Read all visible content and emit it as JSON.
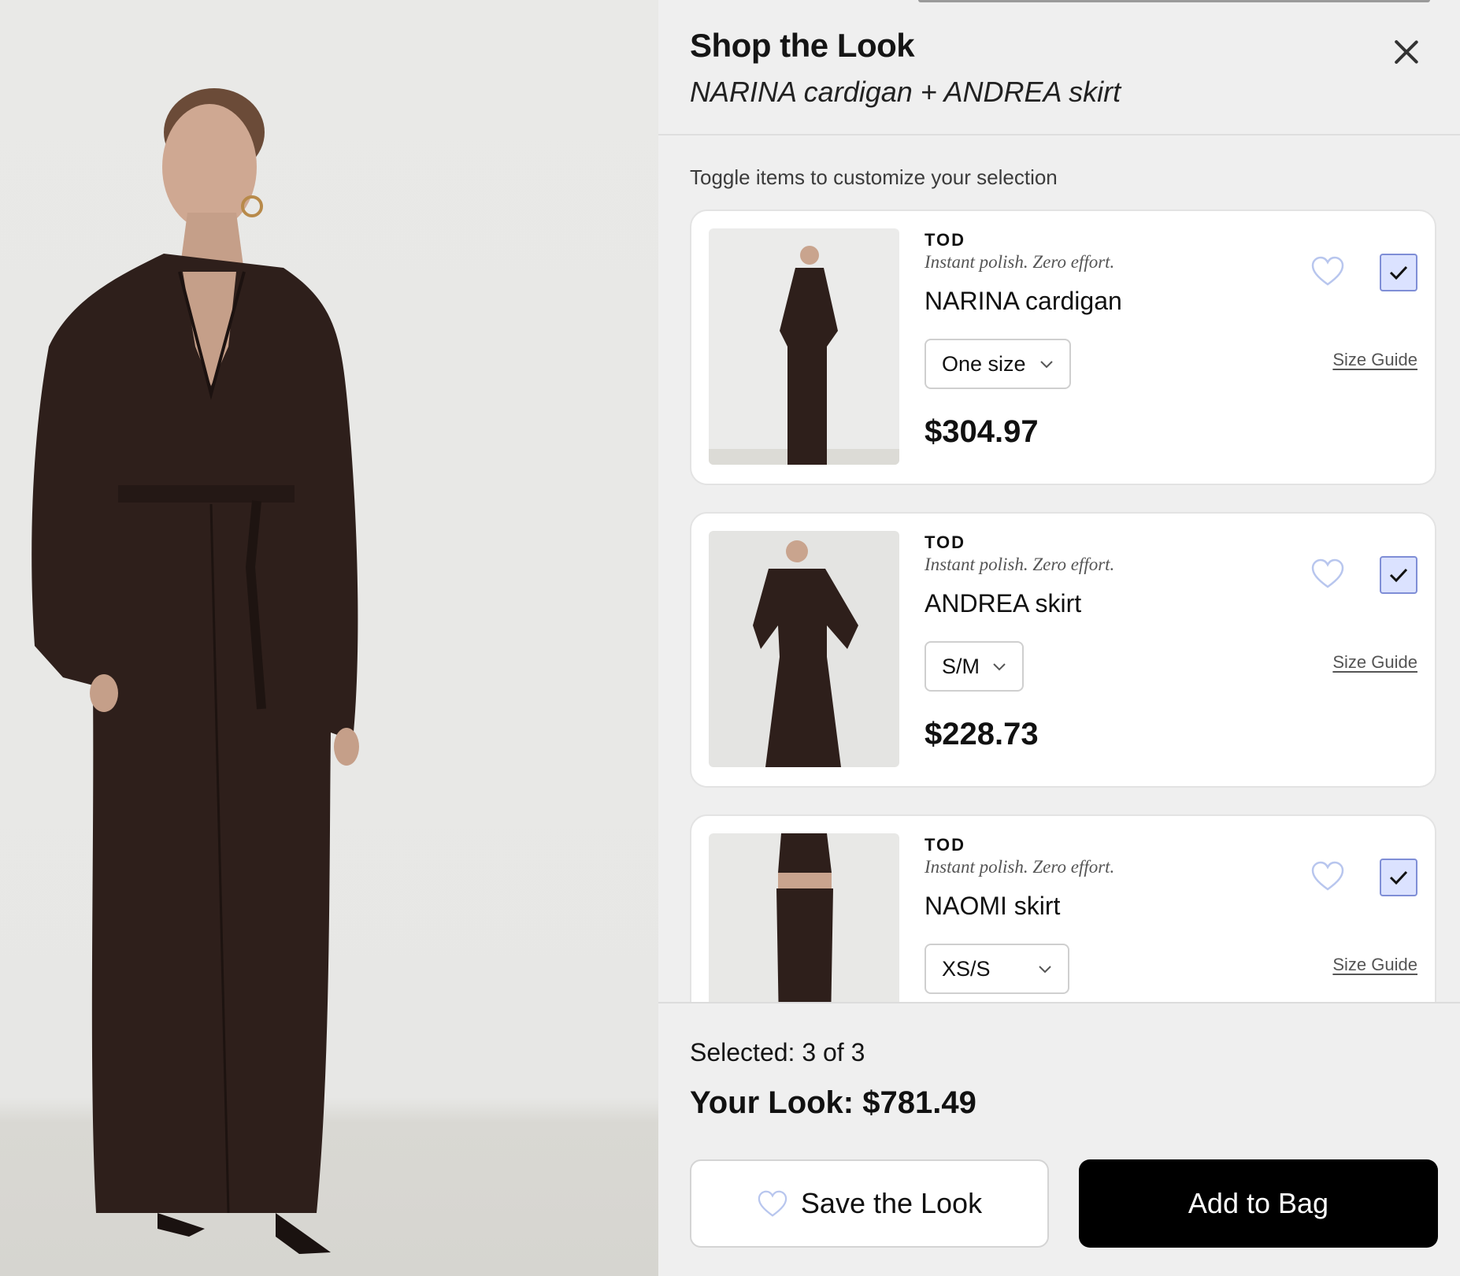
{
  "hero": {
    "alt": "Model wearing long brown belted cardigan over skirt"
  },
  "panel": {
    "title": "Shop the Look",
    "subtitle": "NARINA cardigan + ANDREA skirt",
    "close_icon": "close-icon",
    "hint": "Toggle items to customize your selection"
  },
  "items": [
    {
      "brand": "TOD",
      "tagline": "Instant polish. Zero effort.",
      "name": "NARINA cardigan",
      "size": "One size",
      "size_guide": "Size Guide",
      "price": "$304.97",
      "selected": true,
      "favorite": false
    },
    {
      "brand": "TOD",
      "tagline": "Instant polish. Zero effort.",
      "name": "ANDREA skirt",
      "size": "S/M",
      "size_guide": "Size Guide",
      "price": "$228.73",
      "selected": true,
      "favorite": false
    },
    {
      "brand": "TOD",
      "tagline": "Instant polish. Zero effort.",
      "name": "NAOMI skirt",
      "size": "XS/S",
      "size_guide": "Size Guide",
      "price": "",
      "selected": true,
      "favorite": false
    }
  ],
  "footer": {
    "selected_text": "Selected: 3 of 3",
    "total_text": "Your Look: $781.49",
    "save_label": "Save the Look",
    "add_label": "Add to Bag"
  },
  "colors": {
    "garment": "#2e1f1b",
    "skin": "#c9a48e",
    "check_bg": "#dbe2ff",
    "check_border": "#7f8ed6",
    "primary_button": "#000000"
  }
}
